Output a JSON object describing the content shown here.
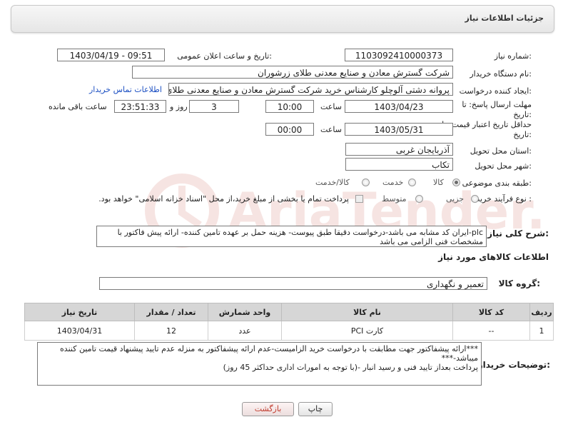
{
  "header": {
    "title": "جزئیات اطلاعات نیاز"
  },
  "form": {
    "need_number_label": "شماره نیاز:",
    "need_number": "1103092410000373",
    "announce_label": "تاریخ و ساعت اعلان عمومی:",
    "announce_value": "1403/04/19 - 09:51",
    "buyer_org_label": "نام دستگاه خریدار:",
    "buyer_org": "شرکت گسترش معادن و صنایع معدنی طلای زرشوران",
    "creator_label": "ایجاد کننده درخواست:",
    "creator": "پروانه  دشتی آلوچلو کارشناس خرید شرکت گسترش معادن و صنایع معدنی طلای زرشوران",
    "contact_link": "اطلاعات تماس خریدار",
    "deadline_label_1": "مهلت ارسال پاسخ: تا",
    "deadline_label_2": "تاریخ:",
    "deadline_date": "1403/04/23",
    "time_label": "ساعت",
    "deadline_time": "10:00",
    "days_value": "3",
    "days_label": "روز و",
    "remaining_time": "23:51:33",
    "remaining_label": "ساعت باقی مانده",
    "validity_label_1": "حداقل تاریخ اعتبار قیمت: تا",
    "validity_label_2": "تاریخ:",
    "validity_date": "1403/05/31",
    "validity_time": "00:00",
    "province_label": "استان محل تحویل:",
    "province": "آذربایجان غربی",
    "city_label": "شهر محل تحویل:",
    "city": "تکاب",
    "category_label": "طبقه بندی موضوعی:",
    "category_options": [
      "کالا",
      "خدمت",
      "کالا/خدمت"
    ],
    "process_label": "نوع فرآیند خرید :",
    "process_options": [
      "جزیی",
      "متوسط"
    ],
    "payment_note": "پرداخت تمام یا بخشی از مبلغ خرید،از محل \"اسناد خزانه اسلامی\" خواهد بود."
  },
  "description": {
    "label": "شرح کلی نیاز:",
    "text": "plc-ایران کد مشابه می باشد-درخواست دقیقا طبق پیوست- هزینه حمل بر عهده تامین کننده- ارائه پیش فاکتور با مشخصات فنی الزامی می باشد"
  },
  "goods_info": {
    "title": "اطلاعات کالاهای مورد نیاز",
    "group_label": "گروه کالا:",
    "group_value": "تعمیر و نگهداری",
    "columns": [
      "ردیف",
      "کد کالا",
      "نام کالا",
      "واحد شمارش",
      "تعداد / مقدار",
      "تاریخ نیاز"
    ],
    "rows": [
      [
        "1",
        "--",
        "کارت PCI",
        "عدد",
        "12",
        "1403/04/31"
      ]
    ]
  },
  "buyer_notes": {
    "label": "توضیحات خریدار:",
    "line1": "***ارائه پیشفاکتور جهت مطابقت با درخواست خرید الزامیست-عدم ارائه پیشفاکتور به منزله عدم تایید پیشنهاد قیمت تامین کننده میباشد-***",
    "line2": "پرداخت بعداز تایید فنی و رسید انبار -(با توجه به امورات اداری حداکثر 45 روز)"
  },
  "buttons": {
    "print": "چاپ",
    "back": "بازگشت"
  },
  "watermark": {
    "text": "AriaTender.net"
  },
  "colors": {
    "link": "#1b4fc2",
    "back_text": "#c0392b",
    "watermark": "#c0392b"
  }
}
